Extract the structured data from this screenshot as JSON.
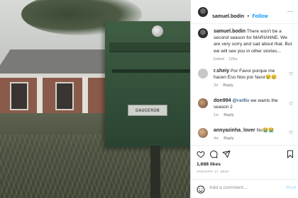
{
  "post": {
    "username": "samuel.bodin",
    "follow_separator": "•",
    "follow_label": "Follow",
    "more_label": "...",
    "caption": {
      "username": "samuel.bodin",
      "text": " There won't be a second season for MARIANNE. We are very sorry and sad about that. But we will see you in other stories...",
      "edited": "Edited",
      "age": "126w"
    },
    "nameplate": "DAUGERON",
    "comments": [
      {
        "username": "r.sheiy",
        "text": " Por Favor porque me hacen Eso Noo por favor😢😢",
        "age": "3d",
        "reply": "Reply"
      },
      {
        "username": "don994",
        "mention": "@netflix",
        "text": " we wants the season 2",
        "age": "1w",
        "reply": "Reply"
      },
      {
        "username": "annyazinha_lover",
        "text": " No😭😭",
        "age": "4w",
        "reply": "Reply"
      }
    ],
    "likes": "1,688 likes",
    "date": "JANUARY 17, 2020",
    "add_comment_placeholder": "Add a comment...",
    "post_button": "Post"
  },
  "icons": {
    "heart": "heart-icon",
    "comment": "comment-icon",
    "share": "share-icon",
    "save": "bookmark-icon",
    "emoji": "smiley-icon"
  },
  "colors": {
    "link": "#0095f6",
    "text": "#262626",
    "meta": "#8e8e8e",
    "post_disabled": "#b2dffc"
  }
}
